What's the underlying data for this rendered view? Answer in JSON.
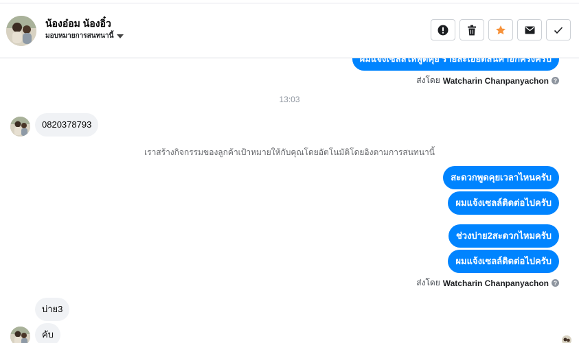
{
  "header": {
    "contact_name": "น้องอ๋อม น้องอิ๋ว",
    "assign_label": "มอบหมายการสนทนานี้",
    "actions": [
      {
        "name": "mark-spam-button",
        "icon": "alert-circle-icon"
      },
      {
        "name": "delete-button",
        "icon": "trash-icon"
      },
      {
        "name": "star-button",
        "icon": "star-icon"
      },
      {
        "name": "mark-unread-button",
        "icon": "envelope-icon"
      },
      {
        "name": "mark-done-button",
        "icon": "check-icon"
      }
    ]
  },
  "thread": {
    "top_partial_message": "ผมแจ้งเซลล์ให้พูดคุย รายละเอียดสินค้าอีกครั้งครับ",
    "sent_by_1": {
      "prefix": "ส่งโดย",
      "name": "Watcharin Chanpanyachon"
    },
    "timestamp": "13:03",
    "incoming_phone": "0820378793",
    "event_text": "เราสร้างกิจกรรมของลูกค้าเป้าหมายให้กับคุณโดยอัตโนมัติโดยอิงตามการสนทนานี้",
    "outgoing": [
      "สะดวกพูดคุยเวลาไหนครับ",
      "ผมแจ้งเซลล์ติดต่อไปครับ",
      "ช่วงบ่าย2สะดวกไหมครับ",
      "ผมแจ้งเซลล์ติดต่อไปครับ"
    ],
    "sent_by_2": {
      "prefix": "ส่งโดย",
      "name": "Watcharin Chanpanyachon"
    },
    "incoming_reply_1": "บ่าย3",
    "incoming_reply_2": "คับ"
  },
  "colors": {
    "outgoing_bubble": "#0084ff",
    "incoming_bubble": "#f0f2f5",
    "star": "#f7923a"
  }
}
